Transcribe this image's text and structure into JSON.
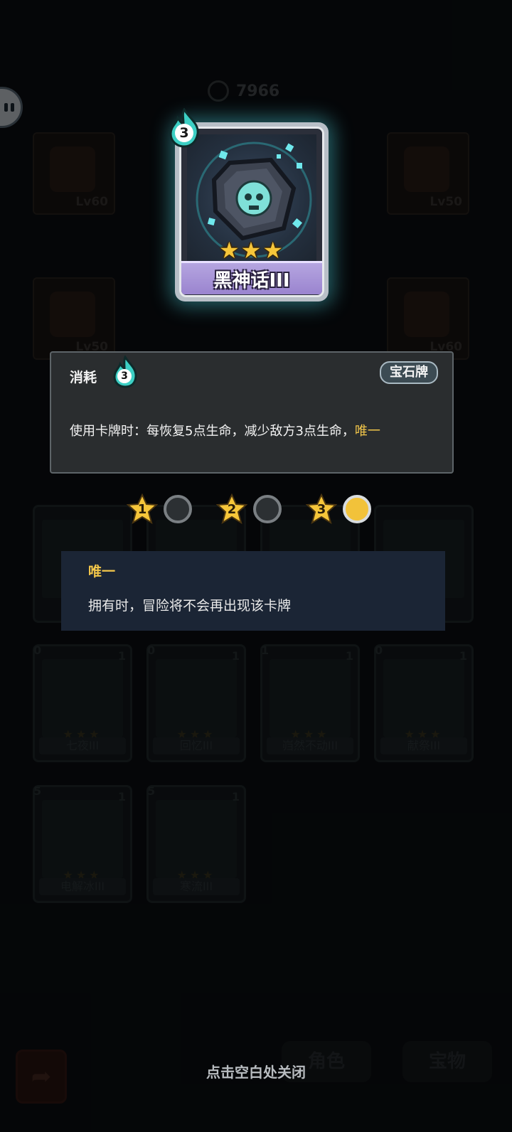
{
  "currency": {
    "amount": "7966",
    "icon": "coin-icon"
  },
  "equipment": [
    {
      "level": "Lv60"
    },
    {
      "level": "Lv50"
    },
    {
      "level": "Lv50"
    },
    {
      "level": "Lv60"
    }
  ],
  "background_cards": [
    {
      "cost": "0",
      "count": "1",
      "name": "七夜III"
    },
    {
      "cost": "0",
      "count": "1",
      "name": "回忆III"
    },
    {
      "cost": "1",
      "count": "1",
      "name": "岿然不动III"
    },
    {
      "cost": "0",
      "count": "1",
      "name": "献祭III"
    },
    {
      "cost": "5",
      "count": "1",
      "name": "电解冰III"
    },
    {
      "cost": "5",
      "count": "1",
      "name": "寒流III"
    }
  ],
  "bottom_nav": {
    "role": "角色",
    "treasure": "宝物"
  },
  "featured_card": {
    "cost": "3",
    "name": "黑神话III",
    "stars": 3,
    "frame_color": "#9a84cf",
    "glow_color": "#50dce6"
  },
  "info": {
    "cost_label": "消耗",
    "cost_value": "3",
    "type_badge": "宝石牌",
    "description": "使用卡牌时：每恢复5点生命，减少敌方3点生命，",
    "keyword": "唯一"
  },
  "levels": [
    {
      "label": "1",
      "selected": false
    },
    {
      "label": "2",
      "selected": false
    },
    {
      "label": "3",
      "selected": true
    }
  ],
  "tooltip": {
    "title": "唯一",
    "description": "拥有时，冒险将不会再出现该卡牌"
  },
  "close_hint": "点击空白处关闭",
  "colors": {
    "highlight": "#f2c64a",
    "star": "#f6c63a",
    "panel": "#2a2d2f",
    "tooltip": "#1b2535"
  }
}
